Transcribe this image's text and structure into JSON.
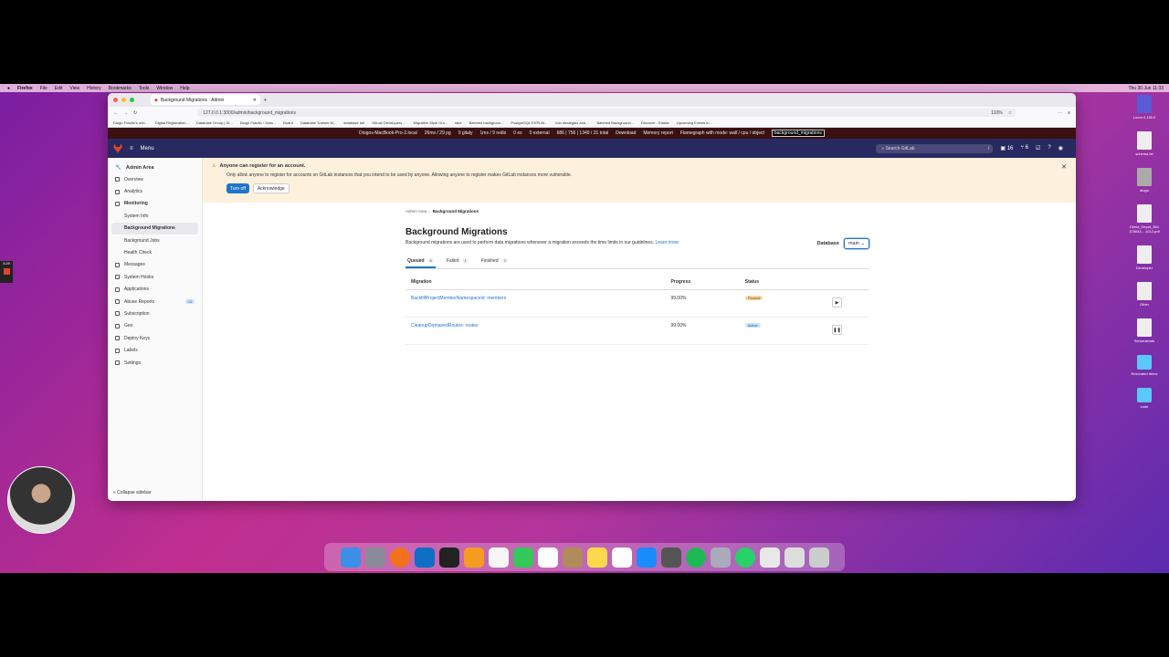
{
  "menubar": {
    "app": "Firefox",
    "items": [
      "File",
      "Edit",
      "View",
      "History",
      "Bookmarks",
      "Tools",
      "Window",
      "Help"
    ],
    "clock": "Thu 30 Jun  11:33"
  },
  "browser": {
    "tab_title": "Background Migrations · Admin",
    "url": "127.0.0.1:3000/admin/background_migrations",
    "zoom": "110%",
    "bookmarks": [
      "Diogo Fracão's onb...",
      "Digital Registration...",
      "Database Group | Gi...",
      "Diogo Fracão › Data...",
      "Board",
      "Database Trainee M...",
      "database lab",
      "GitLab Developers ...",
      "Migration Style Gui...",
      "rake",
      "Batched backgroun...",
      "PostgreSQL EXPLAI...",
      "Join strategies and ...",
      "Batched Background...",
      "Discover - Elastic",
      "Upcoming Events in..."
    ]
  },
  "perfbar": {
    "host": "Diogos-MacBook-Pro-2.local",
    "stats": [
      "26ms / 29 pg",
      "0 gitaly",
      "1ms / 9 redis",
      "0 es",
      "0 external",
      "686 | 756 | 1349 / 31 total",
      "Download",
      "Memory report",
      "Flamegraph with mode: wall / cpu / object"
    ],
    "search_value": "background_migrations"
  },
  "gitlab_nav": {
    "menu_label": "Menu",
    "search_placeholder": "Search GitLab",
    "search_shortcut": "/",
    "issues_count": "16",
    "mr_count": "6"
  },
  "sidebar": {
    "header": "Admin Area",
    "items": [
      {
        "label": "Overview"
      },
      {
        "label": "Analytics"
      },
      {
        "label": "Monitoring"
      },
      {
        "label": "System Info"
      },
      {
        "label": "Background Migrations"
      },
      {
        "label": "Background Jobs"
      },
      {
        "label": "Health Check"
      },
      {
        "label": "Messages"
      },
      {
        "label": "System Hooks"
      },
      {
        "label": "Applications"
      },
      {
        "label": "Abuse Reports",
        "badge": "23"
      },
      {
        "label": "Subscription"
      },
      {
        "label": "Geo"
      },
      {
        "label": "Deploy Keys"
      },
      {
        "label": "Labels"
      },
      {
        "label": "Settings"
      }
    ],
    "collapse_label": "Collapse sidebar"
  },
  "alert": {
    "title": "Anyone can register for an account.",
    "description": "Only allow anyone to register for accounts on GitLab instances that you intend to be used by anyone. Allowing anyone to register makes GitLab instances more vulnerable.",
    "primary_button": "Turn off",
    "secondary_button": "Acknowledge"
  },
  "page": {
    "breadcrumb_parent": "Admin Area",
    "breadcrumb_current": "Background Migrations",
    "title": "Background Migrations",
    "description": "Background migrations are used to perform data migrations whenever a migration exceeds the time limits in our guidelines.",
    "learn_more": "Learn more",
    "database_label": "Database",
    "database_value": "main",
    "tabs": [
      {
        "label": "Queued",
        "count": "2"
      },
      {
        "label": "Failed",
        "count": "1"
      },
      {
        "label": "Finished",
        "count": "3"
      }
    ],
    "table": {
      "headers": [
        "Migration",
        "Progress",
        "Status"
      ],
      "rows": [
        {
          "migration": "BackfillProjectMemberNamespaceId: members",
          "progress": "99.00%",
          "status": "Paused"
        },
        {
          "migration": "CleanupOrphanedRoutes: routes",
          "progress": "99.00%",
          "status": "Active"
        }
      ]
    }
  },
  "desktop_icons": [
    "Loom 0.135.0",
    "schema.txt",
    "diogo",
    "Direkt_Depot_801 378043....1012.pdf",
    "Developer",
    "Other",
    "Screenshots",
    "Relocated Items",
    "code"
  ],
  "timer": "3:29",
  "colors": {
    "accent": "#1f75cb",
    "nav": "#292961",
    "alert_bg": "#fdf1dd"
  }
}
